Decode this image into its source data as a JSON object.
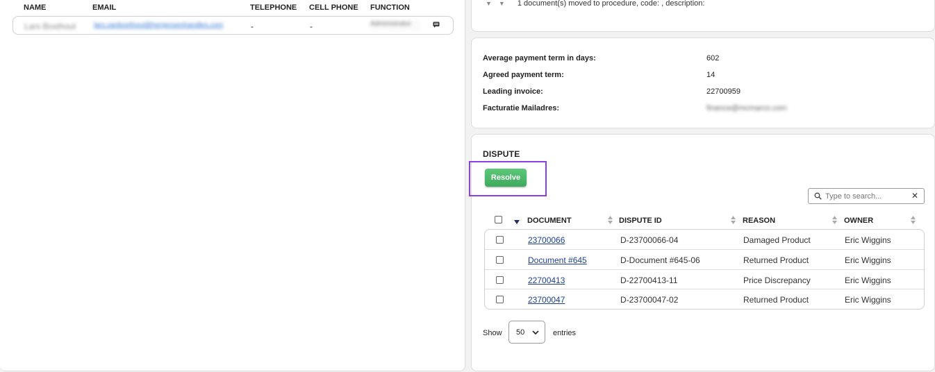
{
  "contacts": {
    "columns": [
      "NAME",
      "EMAIL",
      "TELEPHONE",
      "CELL PHONE",
      "FUNCTION"
    ],
    "row": {
      "name": "Lars Boxthout",
      "email": "lars.vanboxthout@henjensenhandles.com",
      "telephone": "-",
      "cell_phone": "-",
      "function": "Administrator"
    }
  },
  "log": {
    "text": "1 document(s) moved to procedure, code: , description:"
  },
  "info": {
    "avg_term_label": "Average payment term in days:",
    "avg_term_value": "602",
    "agreed_term_label": "Agreed payment term:",
    "agreed_term_value": "14",
    "leading_invoice_label": "Leading invoice:",
    "leading_invoice_value": "22700959",
    "mail_label": "Facturatie Mailadres:",
    "mail_value": "finance@mcmarco.com"
  },
  "dispute": {
    "title": "DISPUTE",
    "resolve_label": "Resolve",
    "search_placeholder": "Type to search...",
    "clear_glyph": "✕",
    "columns": {
      "document": "DOCUMENT",
      "dispute_id": "DISPUTE ID",
      "reason": "REASON",
      "owner": "OWNER"
    },
    "rows": [
      {
        "document": "23700066",
        "dispute_id": "D-23700066-04",
        "reason": "Damaged Product",
        "owner": "Eric Wiggins"
      },
      {
        "document": "Document #645",
        "dispute_id": "D-Document #645-06",
        "reason": "Returned Product",
        "owner": "Eric Wiggins"
      },
      {
        "document": "22700413",
        "dispute_id": "D-22700413-11",
        "reason": "Price Discrepancy",
        "owner": "Eric Wiggins"
      },
      {
        "document": "23700047",
        "dispute_id": "D-23700047-02",
        "reason": "Returned Product",
        "owner": "Eric Wiggins"
      }
    ],
    "show_label": "Show",
    "entries_value": "50",
    "entries_label": "entries"
  },
  "colors": {
    "accent_green": "#3fa95d",
    "highlight_purple": "#8a3ee6",
    "link_blue": "#1c3f94"
  }
}
